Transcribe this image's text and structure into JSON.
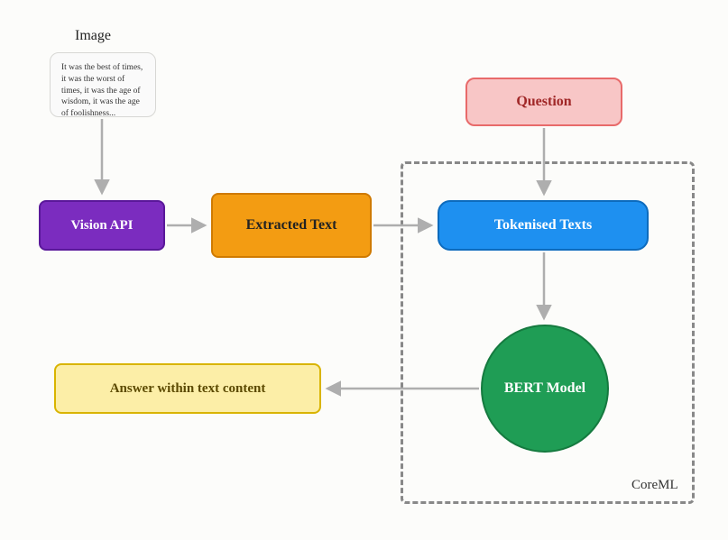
{
  "labels": {
    "image_heading": "Image",
    "image_text": "It was the best of times, it was the worst of times, it was the age of wisdom, it was the age of foolishness...",
    "vision": "Vision API",
    "extracted": "Extracted Text",
    "question": "Question",
    "tokenised": "Tokenised Texts",
    "bert": "BERT Model",
    "answer": "Answer within text content",
    "coreml": "CoreML"
  }
}
